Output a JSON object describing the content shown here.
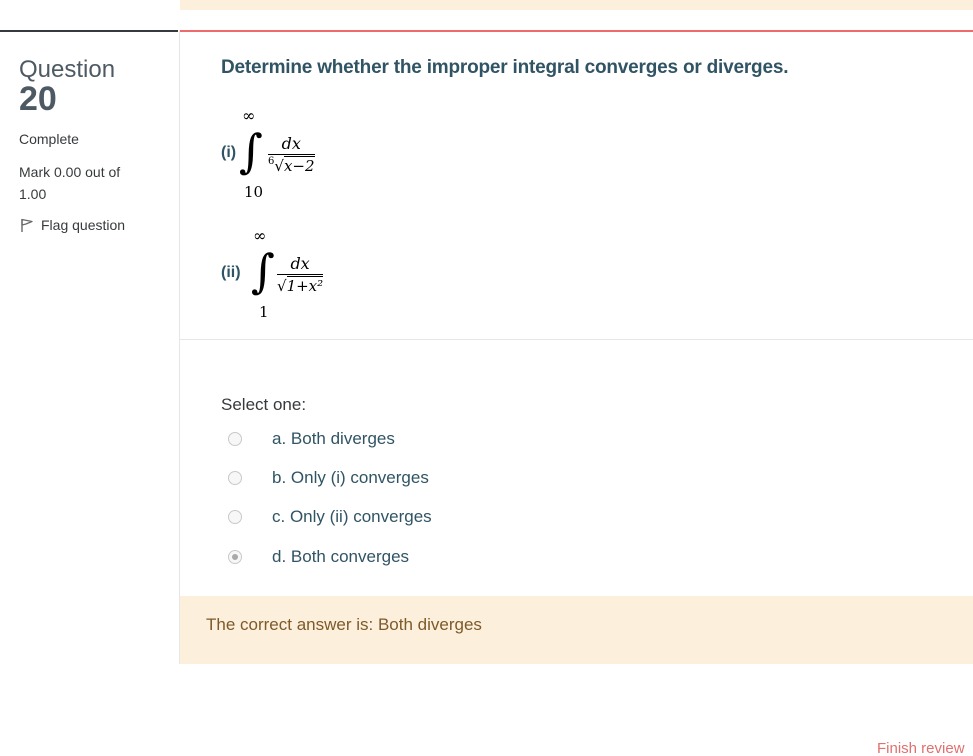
{
  "question": {
    "label": "Question",
    "number": "20",
    "state": "Complete",
    "grade": "Mark 0.00 out of 1.00",
    "flag_label": "Flag question",
    "prompt": "Determine whether the improper integral converges or diverges."
  },
  "integrals": [
    {
      "label": "(i)",
      "upper": "∞",
      "lower": "10",
      "numerator": "dx",
      "root_index": "6",
      "radicand": "x−2"
    },
    {
      "label": "(ii)",
      "upper": "∞",
      "lower": "1",
      "numerator": "dx",
      "root_index": "",
      "radicand": "1+x²"
    }
  ],
  "answer": {
    "prompt": "Select one:",
    "options": [
      {
        "label": "a. Both diverges",
        "selected": false
      },
      {
        "label": "b. Only (i) converges",
        "selected": false
      },
      {
        "label": "c. Only (ii) converges",
        "selected": false
      },
      {
        "label": "d. Both converges",
        "selected": true
      }
    ]
  },
  "feedback": {
    "right_answer": "The correct answer is: Both diverges"
  },
  "footer": {
    "finish_link": "Finish review"
  },
  "colors": {
    "accent_border": "#ef6a6a",
    "question_text": "#305464",
    "feedback_bg": "#fcefdc",
    "feedback_text": "#7d5a29"
  },
  "icons": {
    "flag": "flag-icon"
  }
}
